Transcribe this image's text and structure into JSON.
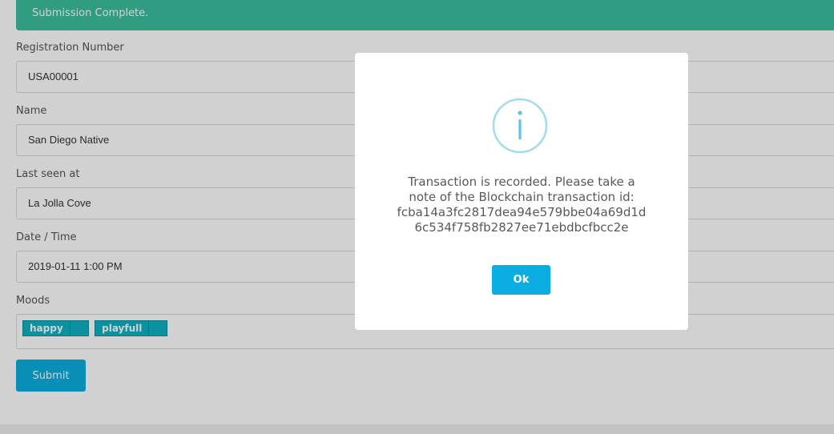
{
  "alert": {
    "message": "Submission Complete."
  },
  "form": {
    "registration": {
      "label": "Registration Number",
      "value": "USA00001"
    },
    "name": {
      "label": "Name",
      "value": "San Diego Native"
    },
    "last_seen": {
      "label": "Last seen at",
      "value": "La Jolla Cove"
    },
    "datetime": {
      "label": "Date / Time",
      "value": "2019-01-11 1:00 PM"
    },
    "moods": {
      "label": "Moods",
      "tags": [
        "happy",
        "playfull"
      ]
    },
    "submit_label": "Submit"
  },
  "modal": {
    "icon": "info-icon",
    "message_lines": [
      "Transaction is recorded. Please take a",
      "note of the Blockchain transaction id:",
      "fcba14a3fc2817dea94e579bbe04a69d1d",
      "6c534f758fb2827ee71ebdbcfbcc2e"
    ],
    "ok_label": "Ok"
  },
  "colors": {
    "alert_bg": "#3bbf9f",
    "primary_button": "#0aaee0",
    "tag_bg": "#0fb1c4",
    "icon_stroke": "#9fdcec"
  }
}
